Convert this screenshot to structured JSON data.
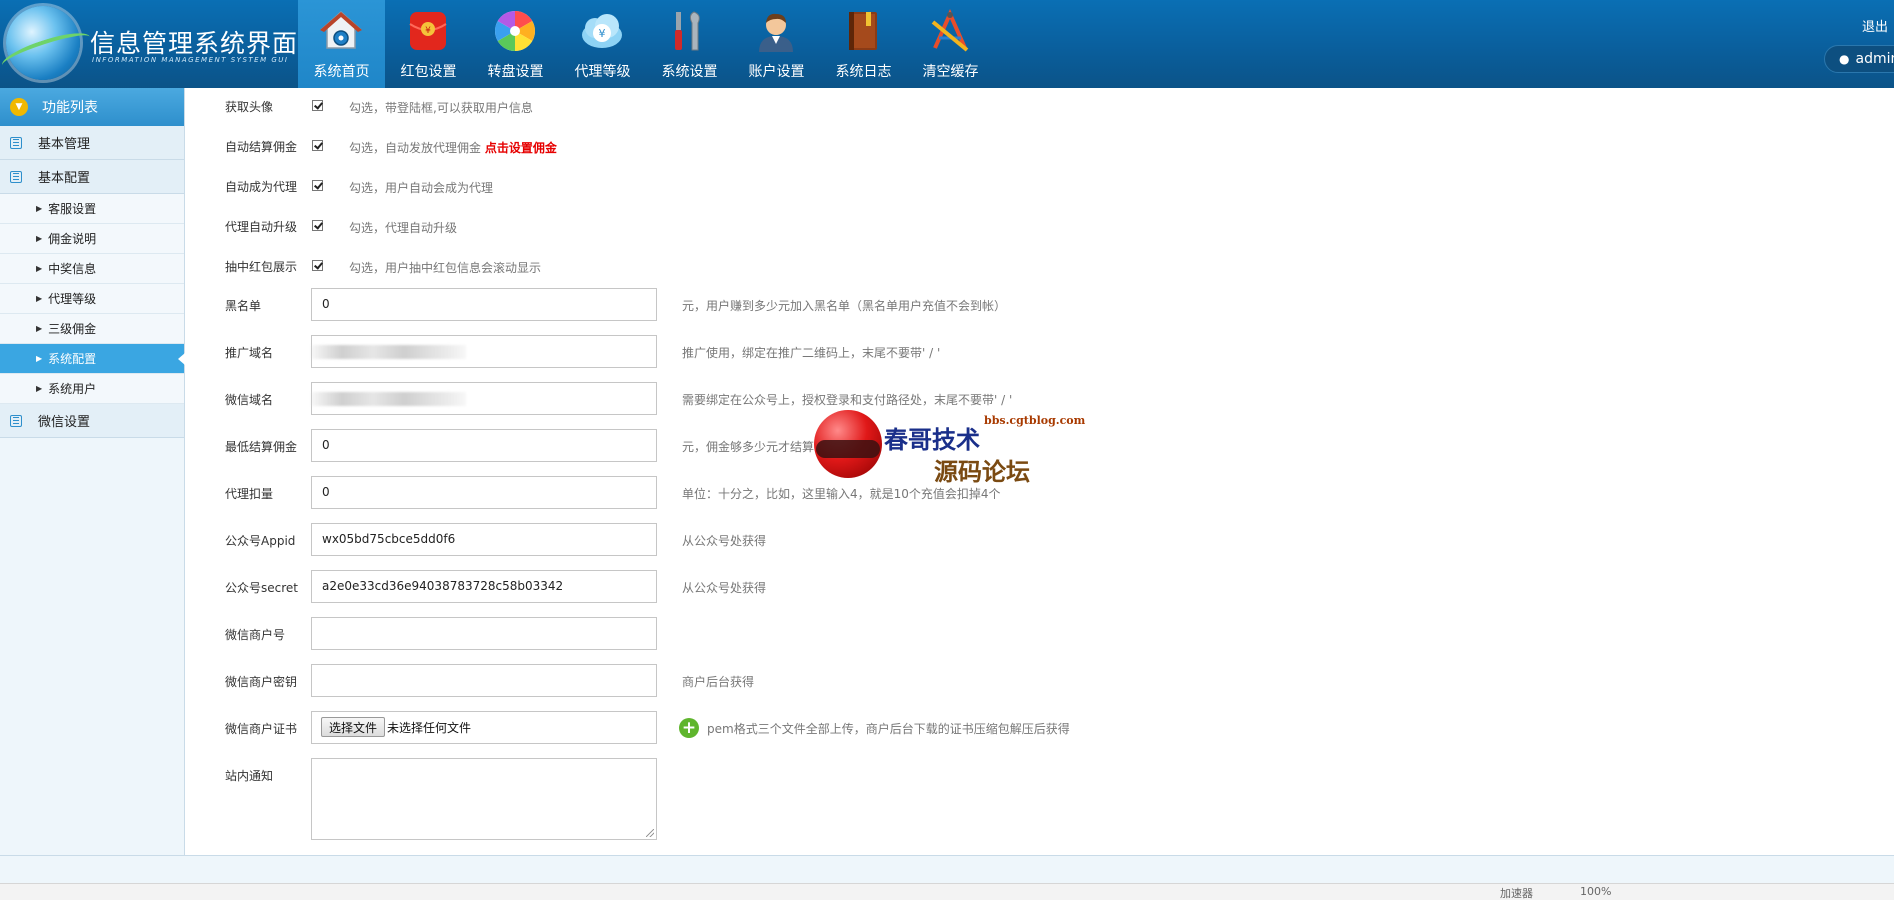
{
  "app": {
    "title": "信息管理系统界面",
    "subtitle": "INFORMATION MANAGEMENT SYSTEM GUI"
  },
  "nav": {
    "items": [
      {
        "label": "系统首页",
        "icon": "home-icon"
      },
      {
        "label": "红包设置",
        "icon": "red-envelope-icon"
      },
      {
        "label": "转盘设置",
        "icon": "color-wheel-icon"
      },
      {
        "label": "代理等级",
        "icon": "yen-cloud-icon"
      },
      {
        "label": "系统设置",
        "icon": "tools-icon"
      },
      {
        "label": "账户设置",
        "icon": "user-account-icon"
      },
      {
        "label": "系统日志",
        "icon": "book-icon"
      },
      {
        "label": "清空缓存",
        "icon": "drafting-tools-icon"
      }
    ],
    "active_index": 0
  },
  "topright": {
    "logout": "退出",
    "user": "admin"
  },
  "sidebar": {
    "header": "功能列表",
    "sections": [
      {
        "label": "基本管理"
      },
      {
        "label": "基本配置"
      },
      {
        "label": "微信设置"
      }
    ],
    "items": [
      {
        "label": "客服设置"
      },
      {
        "label": "佣金说明"
      },
      {
        "label": "中奖信息"
      },
      {
        "label": "代理等级"
      },
      {
        "label": "三级佣金"
      },
      {
        "label": "系统配置"
      },
      {
        "label": "系统用户"
      }
    ],
    "active_item": "系统配置"
  },
  "form": {
    "checkboxes": [
      {
        "label": "获取头像",
        "checked": true,
        "hint": "勾选，带登陆框,可以获取用户信息"
      },
      {
        "label": "自动结算佣金",
        "checked": true,
        "hint": "勾选，自动发放代理佣金",
        "link": "点击设置佣金"
      },
      {
        "label": "自动成为代理",
        "checked": true,
        "hint": "勾选，用户自动会成为代理"
      },
      {
        "label": "代理自动升级",
        "checked": true,
        "hint": "勾选，代理自动升级"
      },
      {
        "label": "抽中红包展示",
        "checked": true,
        "hint": "勾选，用户抽中红包信息会滚动显示"
      }
    ],
    "fields": {
      "blacklist": {
        "label": "黑名单",
        "value": "0",
        "hint": "元，用户赚到多少元加入黑名单（黑名单用户充值不会到帐）"
      },
      "promo_domain": {
        "label": "推广域名",
        "value": "",
        "hint": "推广使用，绑定在推广二维码上，末尾不要带' / '"
      },
      "wechat_domain": {
        "label": "微信域名",
        "value": "",
        "hint": "需要绑定在公众号上，授权登录和支付路径处，末尾不要带' / '"
      },
      "min_commission": {
        "label": "最低结算佣金",
        "value": "0",
        "hint": "元，佣金够多少元才结算"
      },
      "agent_deduct": {
        "label": "代理扣量",
        "value": "0",
        "hint": "单位：十分之，比如，这里输入4，就是10个充值会扣掉4个"
      },
      "appid": {
        "label": "公众号Appid",
        "value": "wx05bd75cbce5dd0f6",
        "hint": "从公众号处获得"
      },
      "secret": {
        "label": "公众号secret",
        "value": "a2e0e33cd36e94038783728c58b03342",
        "hint": "从公众号处获得"
      },
      "merchant_id": {
        "label": "微信商户号",
        "value": "",
        "hint": ""
      },
      "merchant_key": {
        "label": "微信商户密钥",
        "value": "",
        "hint": "商户后台获得"
      },
      "merchant_cert": {
        "label": "微信商户证书",
        "button": "选择文件",
        "file_status": "未选择任何文件",
        "hint": "pem格式三个文件全部上传，商户后台下载的证书压缩包解压后获得"
      },
      "site_notice": {
        "label": "站内通知",
        "value": ""
      }
    }
  },
  "watermark": {
    "url": "bbs.cgtblog.com",
    "line1": "春哥技术",
    "line2": "源码论坛"
  },
  "statusbar": {
    "zoom": "100%",
    "speed": "加速器"
  },
  "colors": {
    "header_bg": "#0a5f9d",
    "nav_active": "#2b95d6",
    "sidebar_active": "#3aa6e2",
    "link_red": "#e60000"
  }
}
